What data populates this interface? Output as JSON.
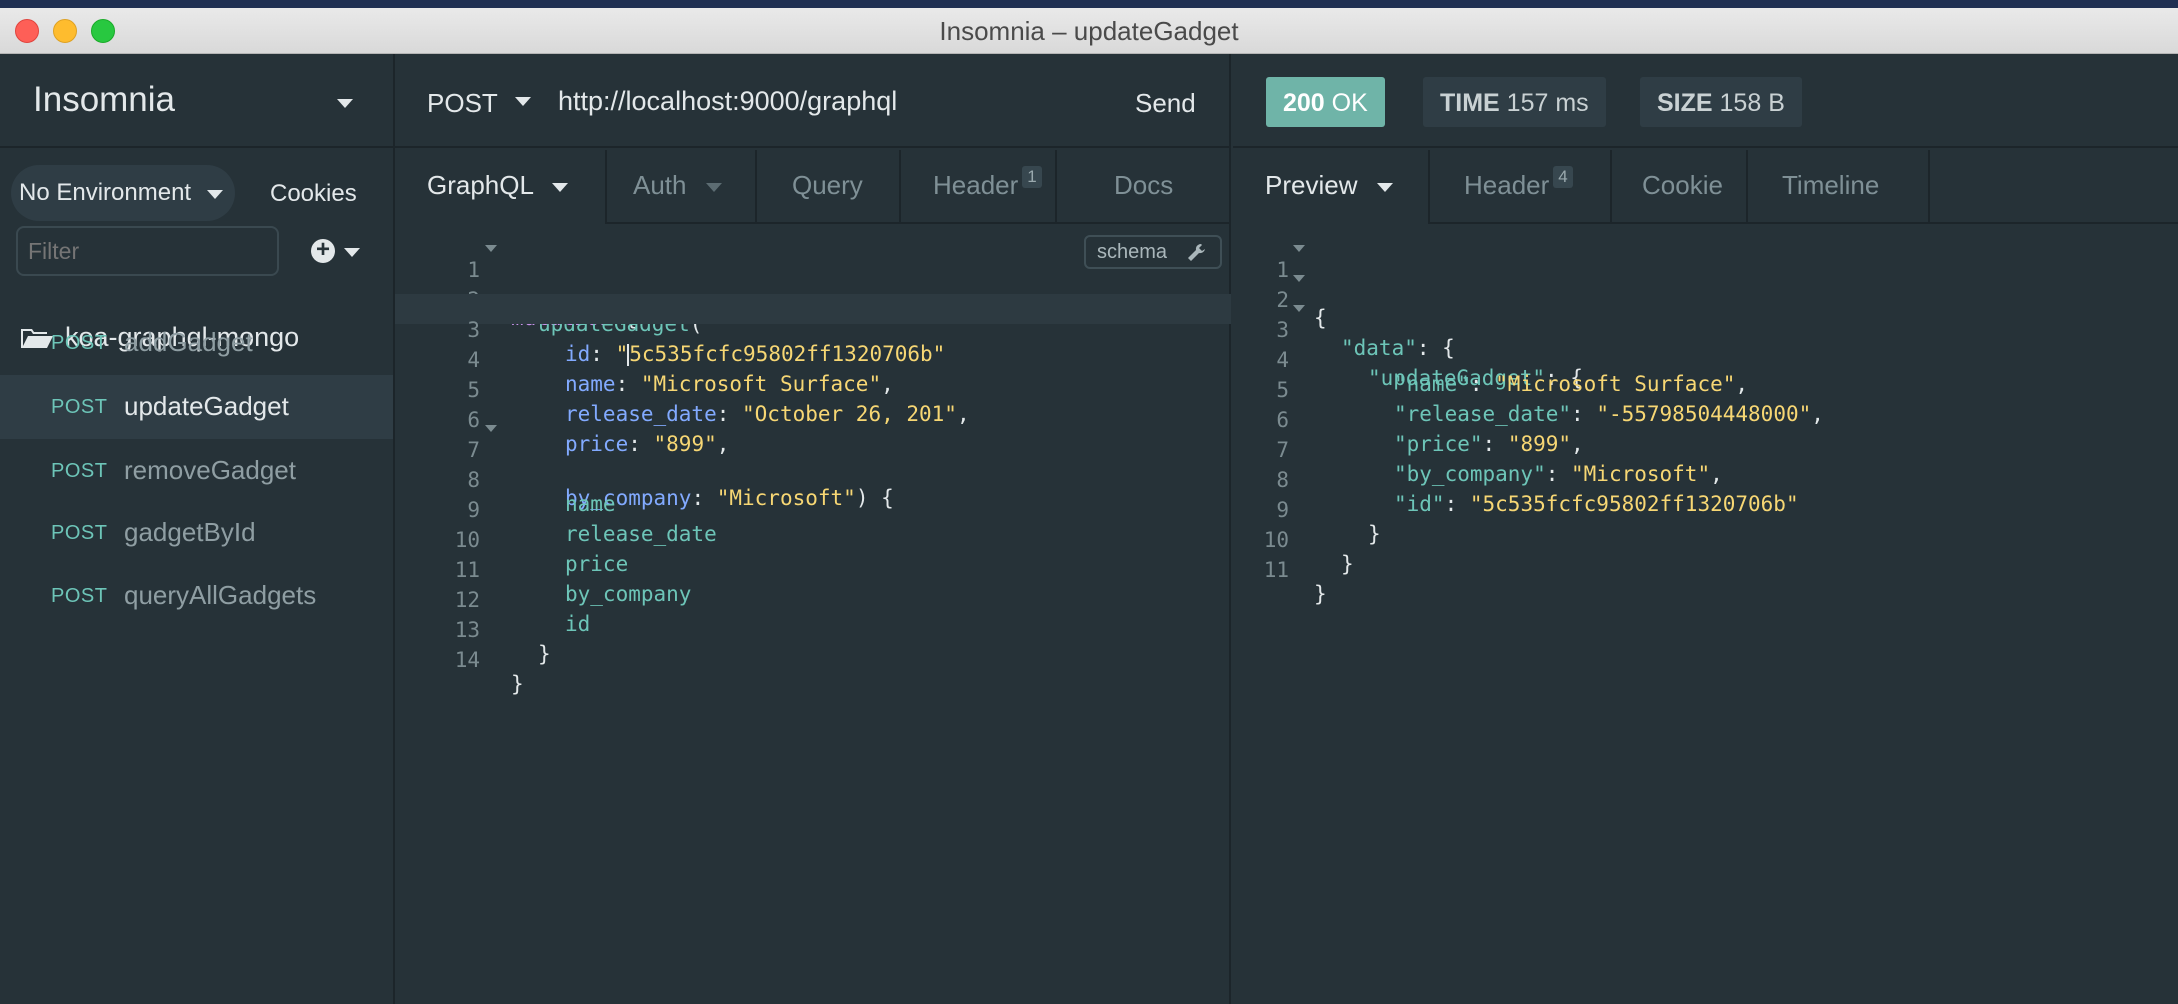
{
  "window": {
    "title": "Insomnia – updateGadget"
  },
  "sidebar": {
    "brand": "Insomnia",
    "environment": "No Environment",
    "cookies": "Cookies",
    "filter_placeholder": "Filter",
    "folder": "koa-graphql-mongo",
    "requests": [
      {
        "method": "POST",
        "name": "addGadget"
      },
      {
        "method": "POST",
        "name": "updateGadget"
      },
      {
        "method": "POST",
        "name": "removeGadget"
      },
      {
        "method": "POST",
        "name": "gadgetById"
      },
      {
        "method": "POST",
        "name": "queryAllGadgets"
      }
    ]
  },
  "request": {
    "method": "POST",
    "url": "http://localhost:9000/graphql",
    "send": "Send",
    "tabs": {
      "graphql": "GraphQL",
      "auth": "Auth",
      "query": "Query",
      "header": "Header",
      "header_count": "1",
      "docs": "Docs"
    },
    "schema_button": "schema",
    "line_numbers": [
      "1",
      "2",
      "3",
      "4",
      "5",
      "6",
      "7",
      "8",
      "9",
      "10",
      "11",
      "12",
      "13",
      "14"
    ],
    "code": {
      "l1_kw": "mutation",
      "l1_rest": " {",
      "l2_fn": "updateGadget",
      "l2_rest": "(",
      "l3_key": "id",
      "l3_colon": ": ",
      "l3_q": "\"",
      "l3_str": "5c535fcfc95802ff1320706b\"",
      "l4_key": "name",
      "l4_colon": ": ",
      "l4_str": "\"Microsoft Surface\"",
      "l4_rest": ",",
      "l5_key": "release_date",
      "l5_colon": ": ",
      "l5_str": "\"October 26, 201\"",
      "l5_rest": ",",
      "l6_key": "price",
      "l6_colon": ": ",
      "l6_str": "\"899\"",
      "l6_rest": ",",
      "l7_key": "by_company",
      "l7_colon": ": ",
      "l7_str": "\"Microsoft\"",
      "l7_rest": ") {",
      "l8": "name",
      "l9": "release_date",
      "l10": "price",
      "l11": "by_company",
      "l12": "id",
      "l13": "}",
      "l14": "}"
    }
  },
  "response": {
    "status_code": "200",
    "status_text": "OK",
    "time_label": "TIME",
    "time_value": "157 ms",
    "size_label": "SIZE",
    "size_value": "158 B",
    "tabs": {
      "preview": "Preview",
      "header": "Header",
      "header_count": "4",
      "cookie": "Cookie",
      "timeline": "Timeline"
    },
    "line_numbers": [
      "1",
      "2",
      "3",
      "4",
      "5",
      "6",
      "7",
      "8",
      "9",
      "10",
      "11"
    ],
    "json": {
      "l1": "{",
      "l2_key": "\"data\"",
      "l2_rest": ": {",
      "l3_key": "\"updateGadget\"",
      "l3_rest": ": {",
      "l4_key": "\"name\"",
      "l4_colon": ": ",
      "l4_str": "\"Microsoft Surface\"",
      "l4_rest": ",",
      "l5_key": "\"release_date\"",
      "l5_colon": ": ",
      "l5_str": "\"-55798504448000\"",
      "l5_rest": ",",
      "l6_key": "\"price\"",
      "l6_colon": ": ",
      "l6_str": "\"899\"",
      "l6_rest": ",",
      "l7_key": "\"by_company\"",
      "l7_colon": ": ",
      "l7_str": "\"Microsoft\"",
      "l7_rest": ",",
      "l8_key": "\"id\"",
      "l8_colon": ": ",
      "l8_str": "\"5c535fcfc95802ff1320706b\"",
      "l9": "}",
      "l10": "}",
      "l11": "}"
    }
  },
  "colors": {
    "background": "#263238",
    "accent": "#6dc5b8",
    "status_ok": "#6fb4a8",
    "string": "#f7d774",
    "keyword": "#c792ea"
  }
}
